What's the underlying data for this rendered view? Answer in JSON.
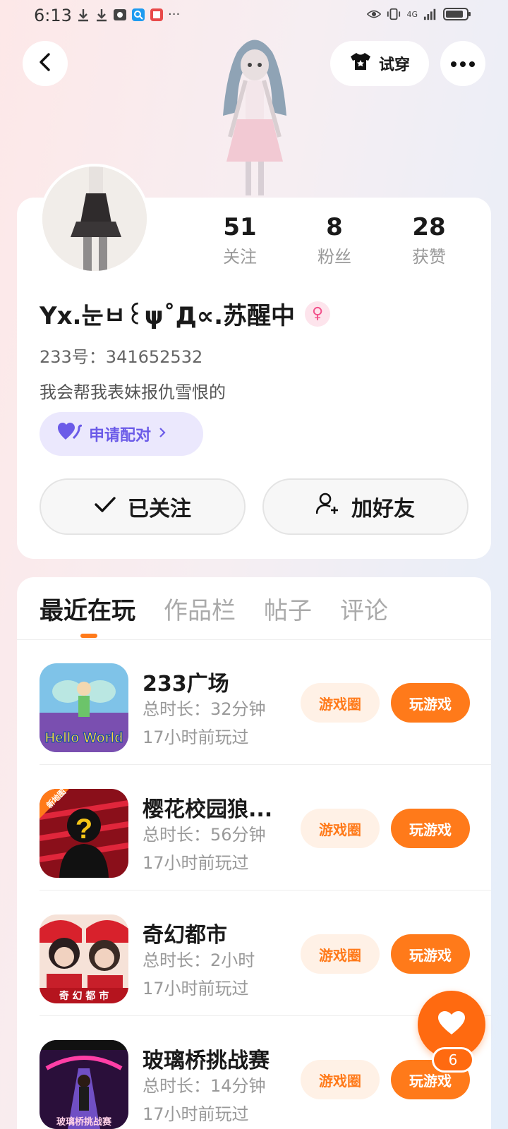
{
  "status_bar": {
    "time": "6:13",
    "more_dots": "···",
    "network_label": "4G"
  },
  "top_bar": {
    "tryon_label": "试穿"
  },
  "profile": {
    "stats": [
      {
        "value": "51",
        "label": "关注"
      },
      {
        "value": "8",
        "label": "粉丝"
      },
      {
        "value": "28",
        "label": "获赞"
      }
    ],
    "username": "Yx.눈ㅂ꒰ψ˚Д∝.苏醒中",
    "gender_symbol": "♀",
    "user_id": "233号：341652532",
    "bio": "我会帮我表妹报仇雪恨的",
    "pair_label": "申请配对",
    "followed_label": "已关注",
    "add_friend_label": "加好友"
  },
  "tabs": [
    {
      "label": "最近在玩",
      "active": true
    },
    {
      "label": "作品栏",
      "active": false
    },
    {
      "label": "帖子",
      "active": false
    },
    {
      "label": "评论",
      "active": false
    }
  ],
  "games": [
    {
      "name": "233广场",
      "time": "总时长：32分钟",
      "last": "17小时前玩过",
      "circle_label": "游戏圈",
      "play_label": "玩游戏",
      "thumb_text": "Hello World"
    },
    {
      "name": "樱花校园狼...",
      "time": "总时长：56分钟",
      "last": "17小时前玩过",
      "circle_label": "游戏圈",
      "play_label": "玩游戏",
      "thumb_text": "新地图"
    },
    {
      "name": "奇幻都市",
      "time": "总时长：2小时",
      "last": "17小时前玩过",
      "circle_label": "游戏圈",
      "play_label": "玩游戏",
      "thumb_text": "奇 幻 都 市"
    },
    {
      "name": "玻璃桥挑战赛",
      "time": "总时长：14分钟",
      "last": "17小时前玩过",
      "circle_label": "游戏圈",
      "play_label": "玩游戏",
      "thumb_text": "玻璃桥挑战赛"
    }
  ],
  "floating_like": {
    "count": "6"
  },
  "colors": {
    "accent": "#ff7a1a",
    "pair_purple": "#6b5be8",
    "gender_pink": "#f2508a"
  }
}
